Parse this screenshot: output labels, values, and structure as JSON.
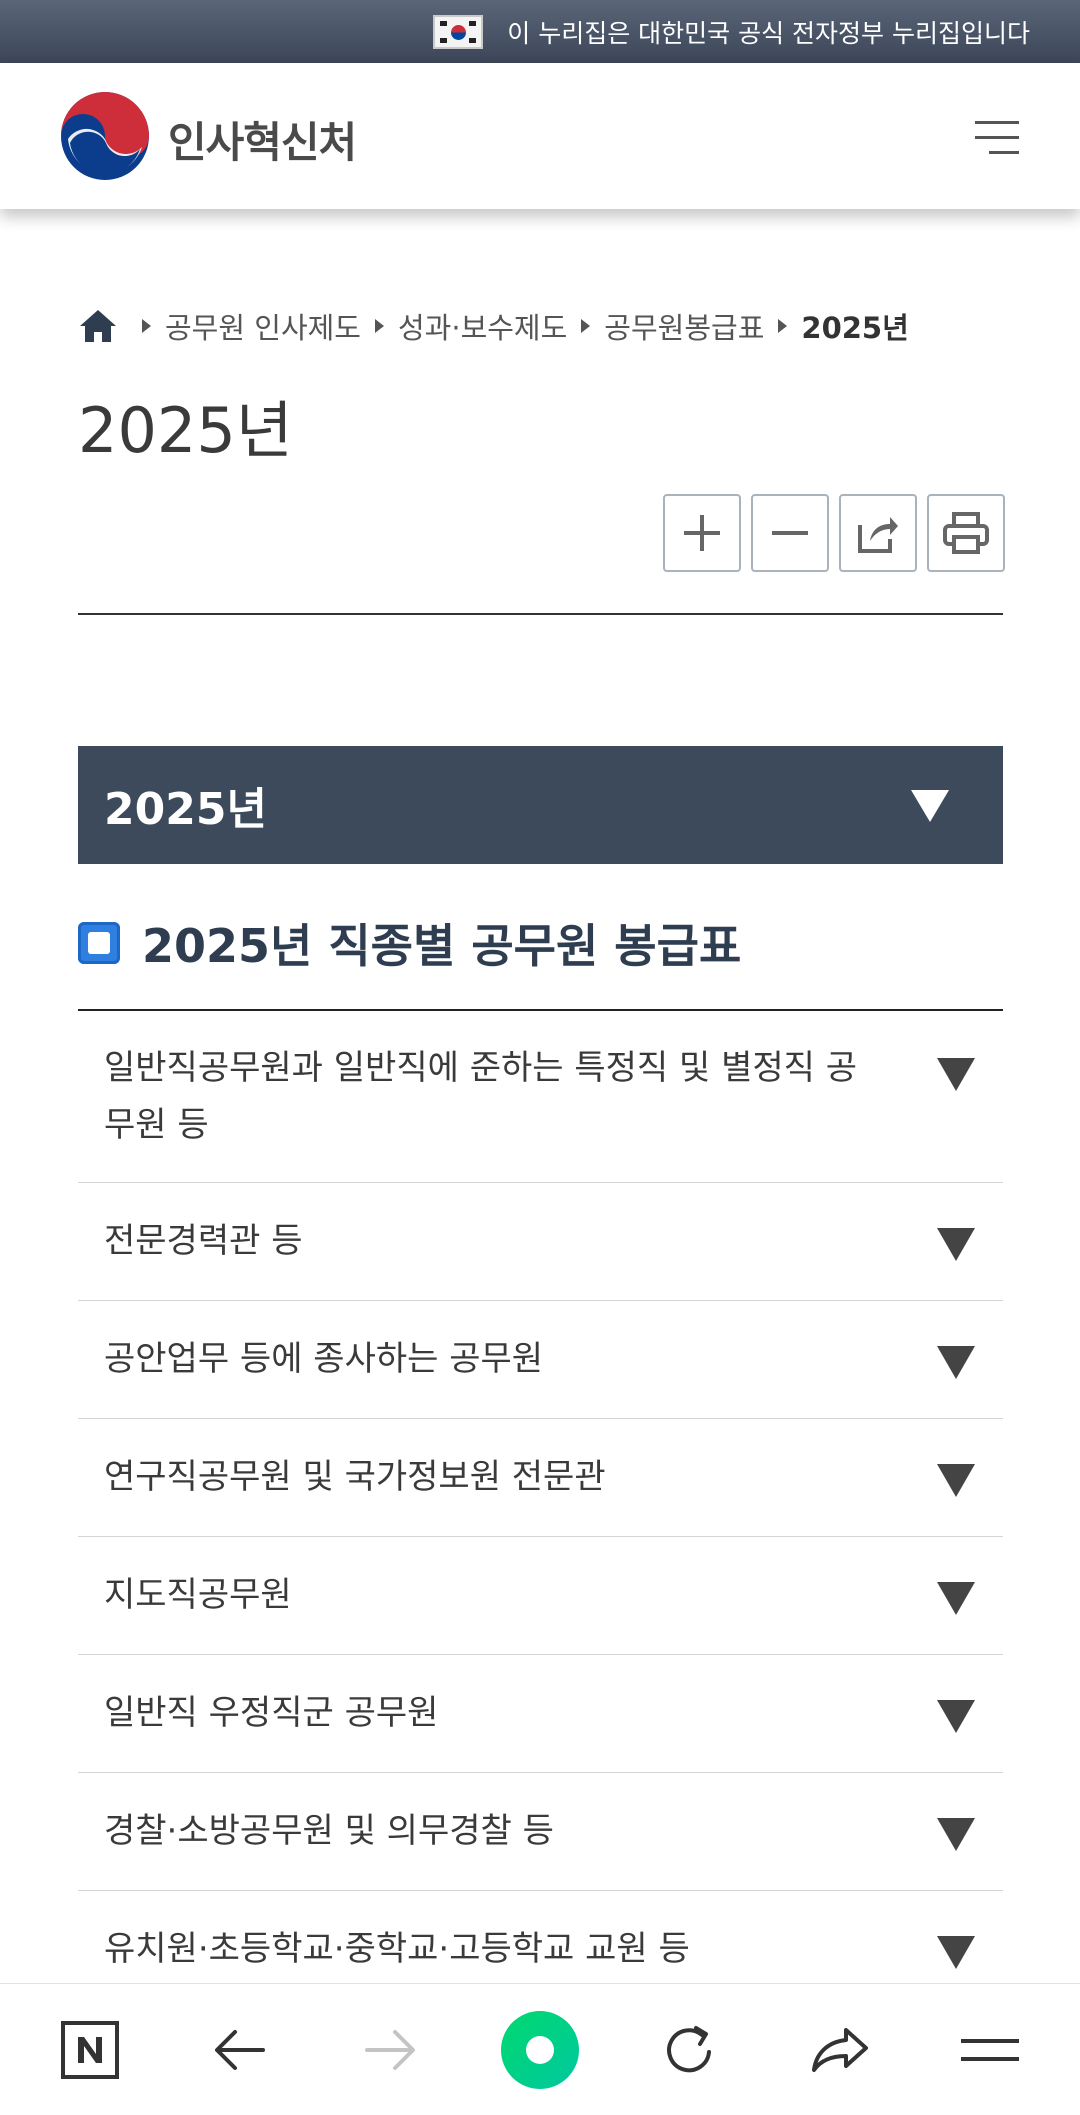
{
  "gov_banner": {
    "text": "이 누리집은 대한민국 공식 전자정부 누리집입니다"
  },
  "header": {
    "logo_text": "인사혁신처"
  },
  "breadcrumb": {
    "items": [
      "공무원 인사제도",
      "성과·보수제도",
      "공무원봉급표"
    ],
    "current": "2025년"
  },
  "page": {
    "title": "2025년"
  },
  "tools": {
    "zoom_in": "zoom-in-icon",
    "zoom_out": "zoom-out-icon",
    "share": "share-icon",
    "print": "print-icon"
  },
  "year_accordion": {
    "label": "2025년"
  },
  "section": {
    "title": "2025년 직종별 공무원 봉급표"
  },
  "salary_tables": [
    {
      "label": "일반직공무원과 일반직에 준하는 특정직 및 별정직 공무원 등"
    },
    {
      "label": "전문경력관 등"
    },
    {
      "label": "공안업무 등에 종사하는 공무원"
    },
    {
      "label": "연구직공무원 및 국가정보원 전문관"
    },
    {
      "label": "지도직공무원"
    },
    {
      "label": "일반직 우정직군 공무원"
    },
    {
      "label": "경찰·소방공무원 및 의무경찰 등"
    },
    {
      "label": "유치원·초등학교·중학교·고등학교 교원 등"
    }
  ],
  "colors": {
    "banner": "#3c4658",
    "year_bar": "#3c4a5c",
    "accent_blue": "#2f7fe0",
    "browser_green": "#03c75a"
  }
}
